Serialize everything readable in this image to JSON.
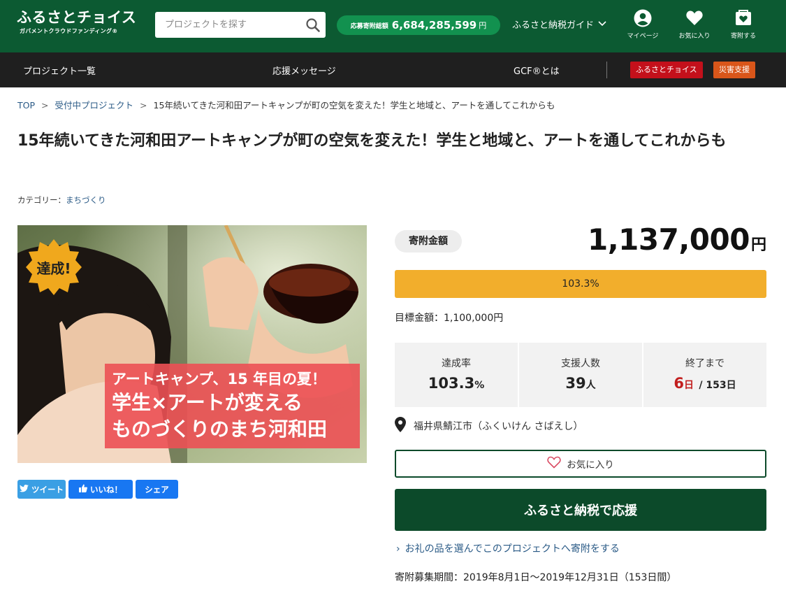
{
  "header": {
    "logo_main": "ふるさとチョイス",
    "logo_sub": "ガバメントクラウドファンディング®",
    "search_placeholder": "プロジェクトを探す",
    "donation_total_label": "応募寄附総額",
    "donation_total_value": "6,684,285,599",
    "donation_total_unit": "円",
    "guide_label": "ふるさと納税ガイド",
    "icons": [
      {
        "label": "マイページ",
        "icon": "user-icon"
      },
      {
        "label": "お気に入り",
        "icon": "heart-icon"
      },
      {
        "label": "寄附する",
        "icon": "donate-icon"
      }
    ]
  },
  "nav": {
    "items": [
      "プロジェクト一覧",
      "応援メッセージ",
      "GCF®とは"
    ],
    "badge_choice": "ふるさとチョイス",
    "badge_disaster": "災害支援",
    "colors": {
      "choice": "#c4101b",
      "disaster": "#d9561a"
    }
  },
  "breadcrumb": {
    "top": "TOP",
    "accepting": "受付中プロジェクト",
    "current": "15年続いてきた河和田アートキャンプが町の空気を変えた！学生と地域と、アートを通してこれからも"
  },
  "project": {
    "title": "15年続いてきた河和田アートキャンプが町の空気を変えた！学生と地域と、アートを通してこれからも",
    "category_label": "カテゴリー：",
    "category": "まちづくり",
    "hero": {
      "badge": "達成!",
      "caption_line1": "アートキャンプ、15 年目の夏！",
      "caption_line2": "学生×アートが変える",
      "caption_line3": "ものづくりのまち河和田"
    },
    "share": {
      "tweet": "ツイート",
      "like": "いいね！",
      "share": "シェア"
    }
  },
  "funding": {
    "amount_label": "寄附金額",
    "amount": "1,137,000",
    "amount_unit": "円",
    "progress_percent": 103.3,
    "progress_text": "103.3%",
    "goal_text": "目標金額：1,100,000円",
    "stats": {
      "rate_label": "達成率",
      "rate_value": "103.3",
      "rate_unit": "%",
      "supporters_label": "支援人数",
      "supporters_value": "39",
      "supporters_unit": "人",
      "remaining_label": "終了まで",
      "remaining_days": "6",
      "remaining_unit": "日",
      "remaining_total": "/ 153日"
    },
    "location": "福井県鯖江市（ふくいけん さばえし）",
    "favorite_button": "お気に入り",
    "support_button": "ふるさと納税で応援",
    "gift_link": "お礼の品を選んでこのプロジェクトへ寄附をする",
    "period": "寄附募集期間：2019年8月1日〜2019年12月31日（153日間）"
  },
  "colors": {
    "header_green": "#0c5a32",
    "nav_dark": "#1f1f1f",
    "accent_green": "#0c4a2a",
    "progress_yellow": "#f2ae2c",
    "remaining_red": "#c21f1f",
    "link_blue": "#2a5a86"
  }
}
